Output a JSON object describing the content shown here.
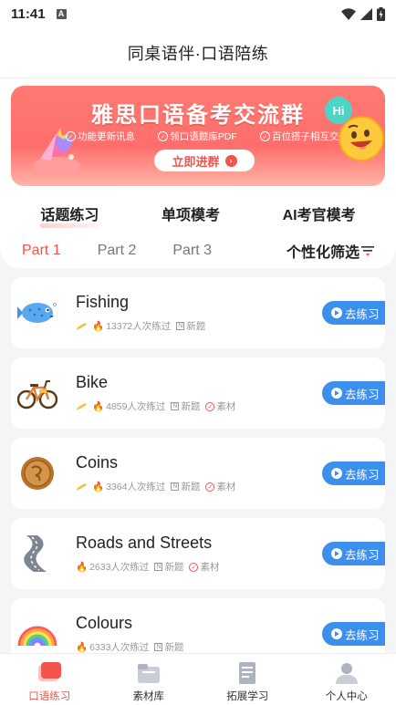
{
  "status": {
    "time": "11:41"
  },
  "header": {
    "title": "同桌语伴·口语陪练"
  },
  "banner": {
    "title": "雅思口语备考交流群",
    "features": [
      "功能更新讯息",
      "领口语题库PDF",
      "百位搭子相互交流"
    ],
    "join_label": "立即进群",
    "hi_label": "Hi"
  },
  "main_tabs": [
    "话题练习",
    "单项模考",
    "AI考官模考"
  ],
  "sub_tabs": [
    "Part 1",
    "Part 2",
    "Part 3"
  ],
  "filter_label": "个性化筛选",
  "practice_label": "去练习",
  "topics": [
    {
      "title": "Fishing",
      "count": "13372人次练过",
      "tags": [
        "新题"
      ]
    },
    {
      "title": "Bike",
      "count": "4859人次练过",
      "tags": [
        "新题",
        "素材"
      ]
    },
    {
      "title": "Coins",
      "count": "3364人次练过",
      "tags": [
        "新题",
        "素材"
      ]
    },
    {
      "title": "Roads and Streets",
      "count": "2633人次练过",
      "tags": [
        "新题",
        "素材"
      ]
    },
    {
      "title": "Colours",
      "count": "6333人次练过",
      "tags": [
        "新题"
      ]
    }
  ],
  "bottom_nav": [
    {
      "label": "口语练习",
      "active": true
    },
    {
      "label": "素材库",
      "active": false
    },
    {
      "label": "拓展学习",
      "active": false
    },
    {
      "label": "个人中心",
      "active": false
    }
  ],
  "colors": {
    "accent": "#f4524c",
    "button": "#3d8fee"
  }
}
